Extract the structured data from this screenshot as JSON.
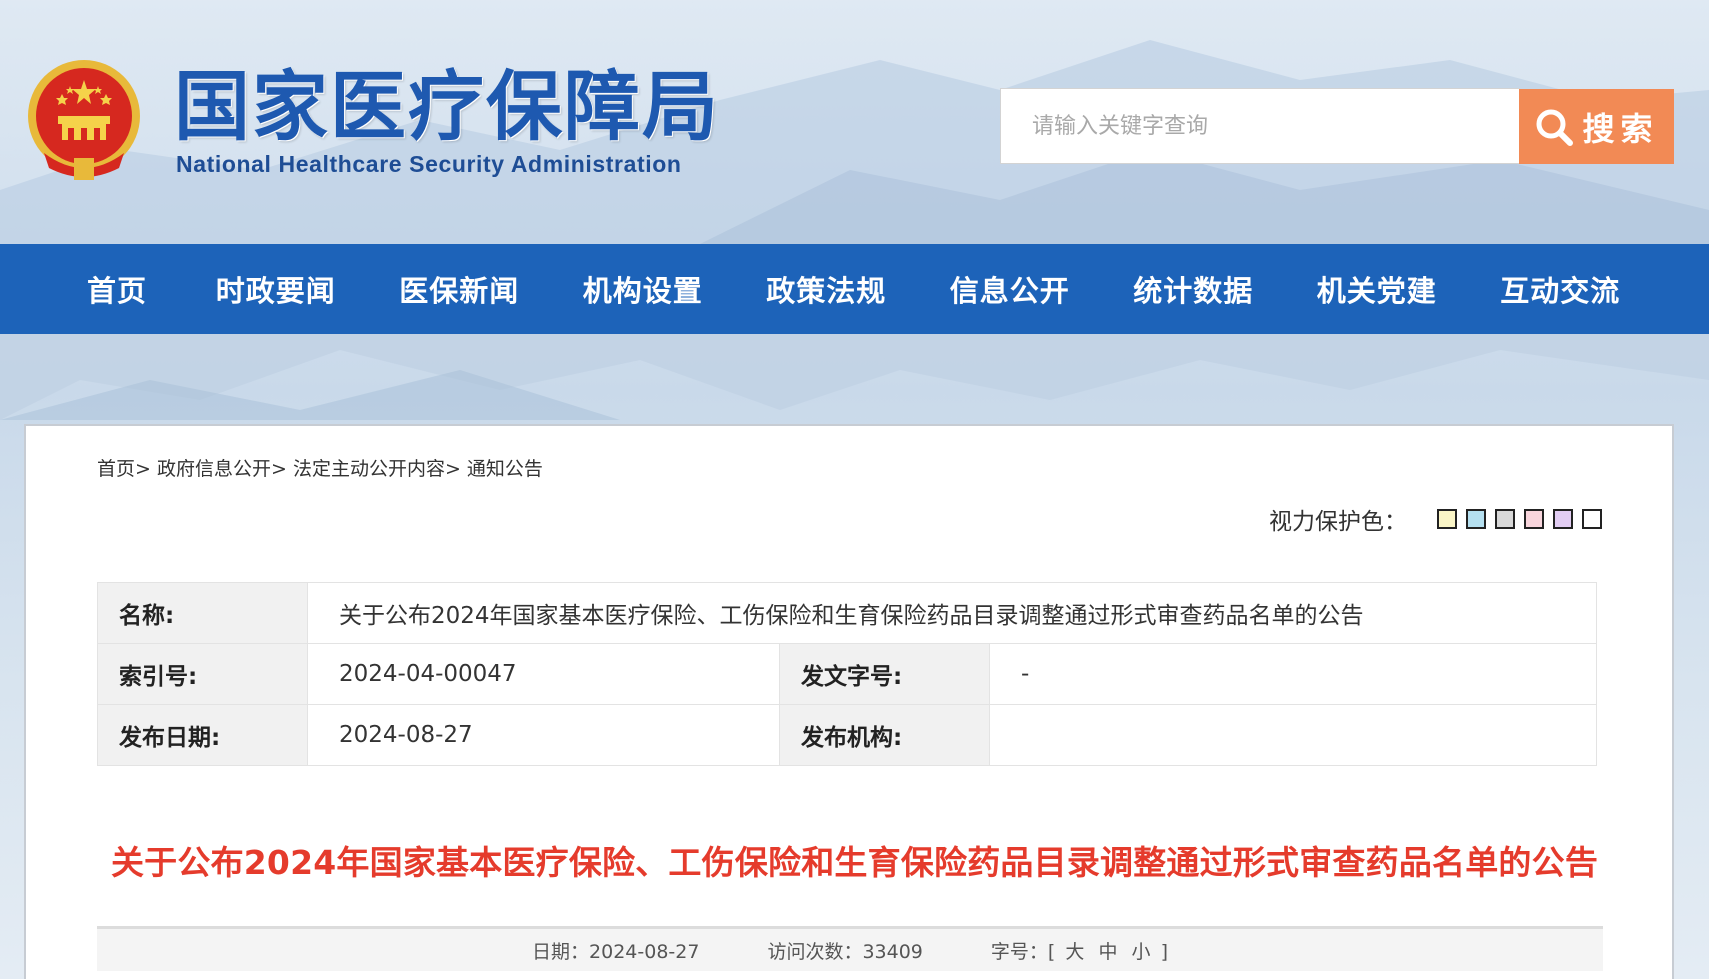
{
  "header": {
    "title_cn": "国家医疗保障局",
    "title_en": "National Healthcare Security Administration",
    "search_placeholder": "请输入关键字查询",
    "search_button": "搜索"
  },
  "nav": {
    "items": [
      "首页",
      "时政要闻",
      "医保新闻",
      "机构设置",
      "政策法规",
      "信息公开",
      "统计数据",
      "机关党建",
      "互动交流"
    ]
  },
  "breadcrumb": {
    "items": [
      "首页>",
      "政府信息公开>",
      "法定主动公开内容>",
      "通知公告"
    ]
  },
  "eye_care": {
    "label": "视力保护色：",
    "swatches": [
      "#faf5c6",
      "#b5e0f0",
      "#d8d8d8",
      "#f8d5dc",
      "#e2cdf3",
      "#ffffff"
    ]
  },
  "meta": {
    "name_key": "名称:",
    "name_value": "关于公布2024年国家基本医疗保险、工伤保险和生育保险药品目录调整通过形式审查药品名单的公告",
    "index_key": "索引号:",
    "index_value": "2024-04-00047",
    "doc_no_key": "发文字号:",
    "doc_no_value": "-",
    "date_key": "发布日期:",
    "date_value": "2024-08-27",
    "org_key": "发布机构:",
    "org_value": ""
  },
  "article": {
    "title": "关于公布2024年国家基本医疗保险、工伤保险和生育保险药品目录调整通过形式审查药品名单的公告",
    "date_label": "日期：",
    "date_value": "2024-08-27",
    "visits_label": "访问次数：",
    "visits_value": "33409",
    "fontsize_label": "字号：",
    "fontsize_open": "[",
    "fontsize_large": "大",
    "fontsize_medium": "中",
    "fontsize_small": "小",
    "fontsize_close": "]"
  },
  "colors": {
    "nav_bg": "#1d63b9",
    "search_btn": "#f28a55",
    "article_title": "#e53b2c"
  }
}
